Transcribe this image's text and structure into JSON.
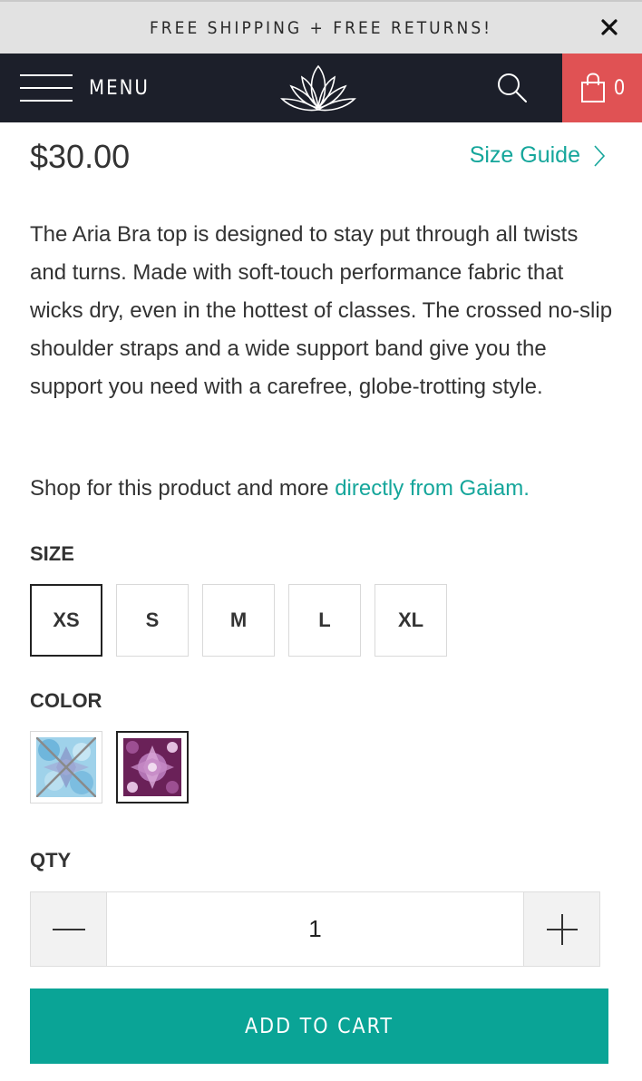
{
  "announcement": {
    "text": "FREE SHIPPING + FREE RETURNS!",
    "close_icon": "close-icon"
  },
  "header": {
    "menu_label": "MENU",
    "menu_icon": "hamburger-icon",
    "logo_icon": "lotus-logo",
    "search_icon": "search-icon",
    "cart_icon": "shopping-bag-icon",
    "cart_count": "0",
    "cart_color": "#e05254",
    "background": "#1c1f2a"
  },
  "product": {
    "price": "$30.00",
    "size_guide_label": "Size Guide",
    "description": "The Aria Bra top is designed to stay put through all twists and turns. Made with soft-touch performance fabric that wicks dry, even in the hottest of classes. The crossed no-slip shoulder straps and a wide support band give you the support you need with a carefree, globe-trotting style.",
    "shop_prefix": "Shop for this product and more ",
    "shop_link": "directly from Gaiam."
  },
  "options": {
    "size_label": "SIZE",
    "sizes": [
      "XS",
      "S",
      "M",
      "L",
      "XL"
    ],
    "selected_size": "XS",
    "color_label": "COLOR",
    "colors": [
      {
        "name": "blue-pattern",
        "available": false
      },
      {
        "name": "purple-pattern",
        "available": true,
        "selected": true
      }
    ]
  },
  "quantity": {
    "label": "QTY",
    "value": "1",
    "minus_icon": "minus-icon",
    "plus_icon": "plus-icon"
  },
  "cart": {
    "add_label": "ADD TO CART",
    "accent": "#0aa496"
  },
  "accent_link_color": "#15a69b"
}
